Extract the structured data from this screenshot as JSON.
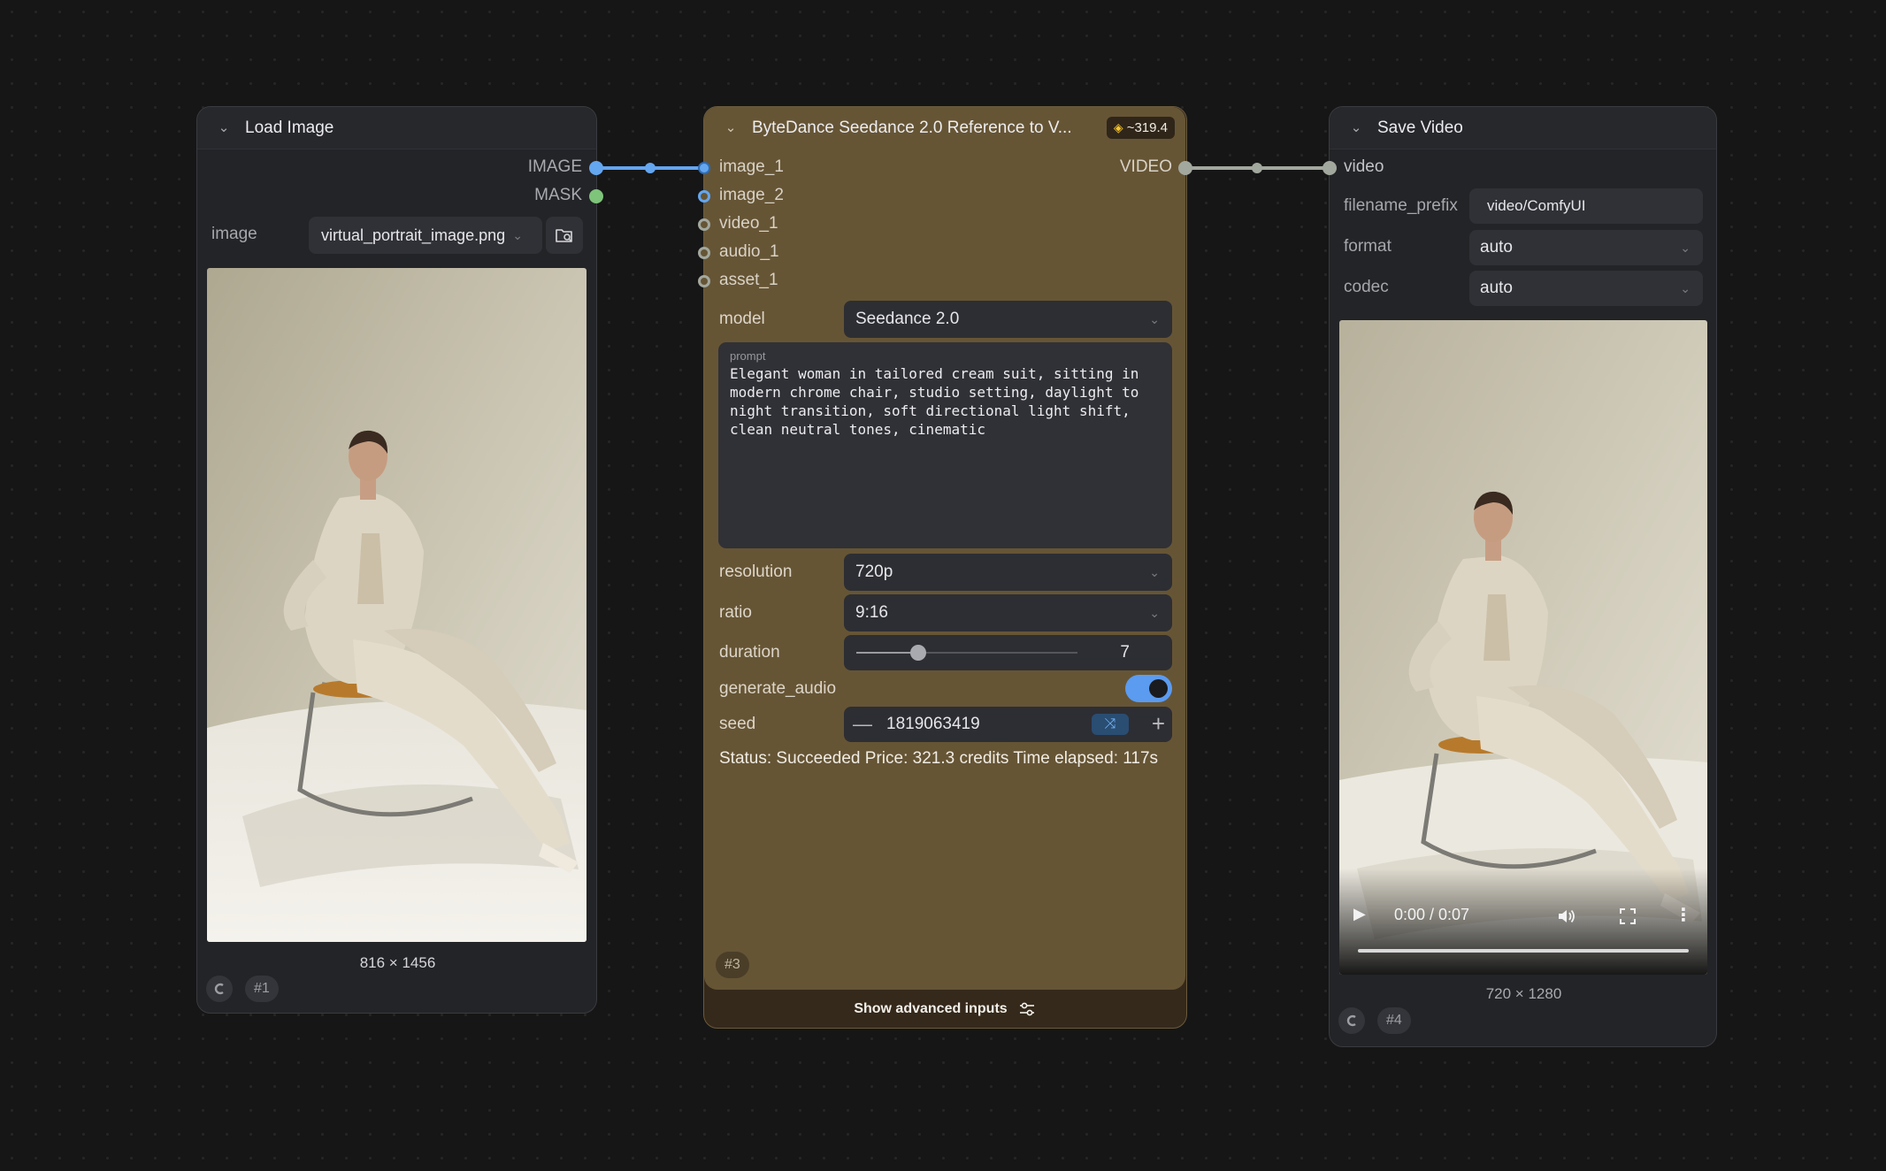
{
  "load_image": {
    "title": "Load Image",
    "outputs": [
      "IMAGE",
      "MASK"
    ],
    "image_label": "image",
    "image_value": "virtual_portrait_image.png",
    "dimensions": "816 × 1456",
    "node_id": "#1"
  },
  "seedance": {
    "title": "ByteDance Seedance 2.0 Reference to V...",
    "price_badge": "~319.4",
    "inputs": [
      "image_1",
      "image_2",
      "video_1",
      "audio_1",
      "asset_1"
    ],
    "output": "VIDEO",
    "model_label": "model",
    "model_value": "Seedance 2.0",
    "prompt_label": "prompt",
    "prompt_text": "Elegant woman in tailored cream suit, sitting in\nmodern chrome chair, studio setting, daylight to\nnight transition, soft directional light shift,\nclean neutral tones, cinematic",
    "resolution_label": "resolution",
    "resolution_value": "720p",
    "ratio_label": "ratio",
    "ratio_value": "9:16",
    "duration_label": "duration",
    "duration_value": "7",
    "duration_fraction": 0.28,
    "generate_audio_label": "generate_audio",
    "generate_audio_on": true,
    "seed_label": "seed",
    "seed_value": "1819063419",
    "status_text": "Status: Succeeded Price: 321.3 credits Time elapsed: 117s",
    "node_id": "#3",
    "advanced_label": "Show advanced inputs"
  },
  "save_video": {
    "title": "Save Video",
    "input": "video",
    "filename_prefix_label": "filename_prefix",
    "filename_prefix_value": "video/ComfyUI",
    "format_label": "format",
    "format_value": "auto",
    "codec_label": "codec",
    "codec_value": "auto",
    "time_display": "0:00 / 0:07",
    "dimensions": "720 × 1280",
    "node_id": "#4"
  },
  "colors": {
    "image_wire": "#64a6f0",
    "mask_socket": "#7ec47a",
    "video_wire": "#a3a89e",
    "seedance_body": "#665535",
    "toggle_on": "#5b9bf0"
  }
}
